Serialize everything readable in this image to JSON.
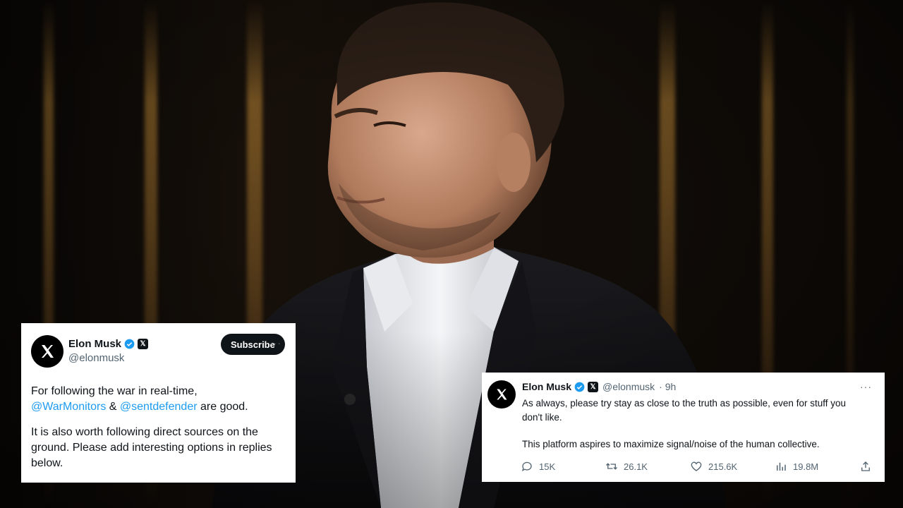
{
  "tweet_left": {
    "name": "Elon Musk",
    "handle": "@elonmusk",
    "subscribe_label": "Subscribe",
    "more_label": "···",
    "line1": "For following the war in real-time,",
    "mention1": "@WarMonitors",
    "amp": " & ",
    "mention2": "@sentdefender",
    "line2_tail": " are good.",
    "paragraph2": "It is also worth following direct sources on the ground. Please add interesting options in replies below."
  },
  "tweet_right": {
    "name": "Elon Musk",
    "handle": "@elonmusk",
    "time": "· 9h",
    "more_label": "···",
    "paragraph1": "As always, please try stay as close to the truth as possible, even for stuff you don't like.",
    "paragraph2": "This platform aspires to maximize signal/noise of the human collective.",
    "replies": "15K",
    "reposts": "26.1K",
    "likes": "215.6K",
    "views": "19.8M"
  },
  "icons": {
    "x_logo": "x-logo-icon",
    "verified": "verified-badge-icon",
    "reply": "reply-icon",
    "repost": "repost-icon",
    "like": "heart-icon",
    "views": "views-icon",
    "share": "share-icon"
  },
  "colors": {
    "link": "#1d9bf0",
    "text": "#0f1419",
    "muted": "#536471",
    "verified": "#1d9bf0"
  }
}
